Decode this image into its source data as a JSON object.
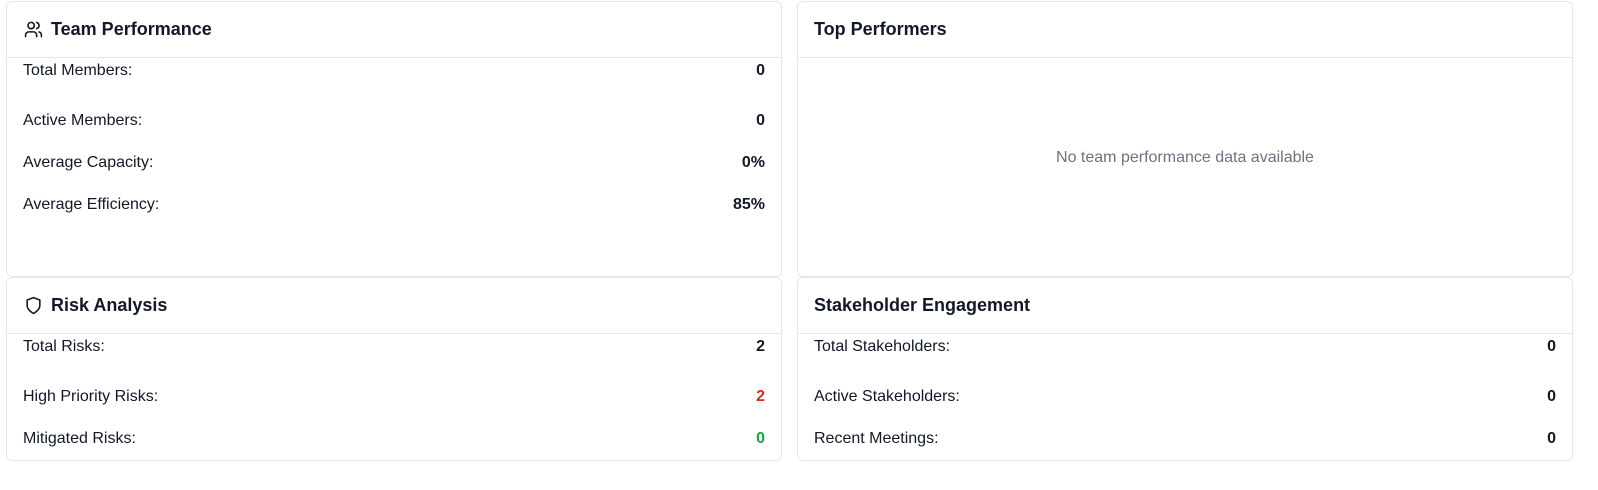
{
  "team_performance": {
    "title": "Team Performance",
    "icon": "users-icon",
    "rows": [
      {
        "label": "Total Members:",
        "value": "0"
      },
      {
        "label": "Active Members:",
        "value": "0"
      },
      {
        "label": "Average Capacity:",
        "value": "0%"
      },
      {
        "label": "Average Efficiency:",
        "value": "85%"
      }
    ]
  },
  "top_performers": {
    "title": "Top Performers",
    "empty_text": "No team performance data available"
  },
  "risk_analysis": {
    "title": "Risk Analysis",
    "icon": "shield-icon",
    "rows": [
      {
        "label": "Total Risks:",
        "value": "2",
        "color": "#111827"
      },
      {
        "label": "High Priority Risks:",
        "value": "2",
        "color": "#dc2626"
      },
      {
        "label": "Mitigated Risks:",
        "value": "0",
        "color": "#16a34a"
      }
    ]
  },
  "stakeholder_engagement": {
    "title": "Stakeholder Engagement",
    "rows": [
      {
        "label": "Total Stakeholders:",
        "value": "0"
      },
      {
        "label": "Active Stakeholders:",
        "value": "0"
      },
      {
        "label": "Recent Meetings:",
        "value": "0"
      }
    ]
  }
}
